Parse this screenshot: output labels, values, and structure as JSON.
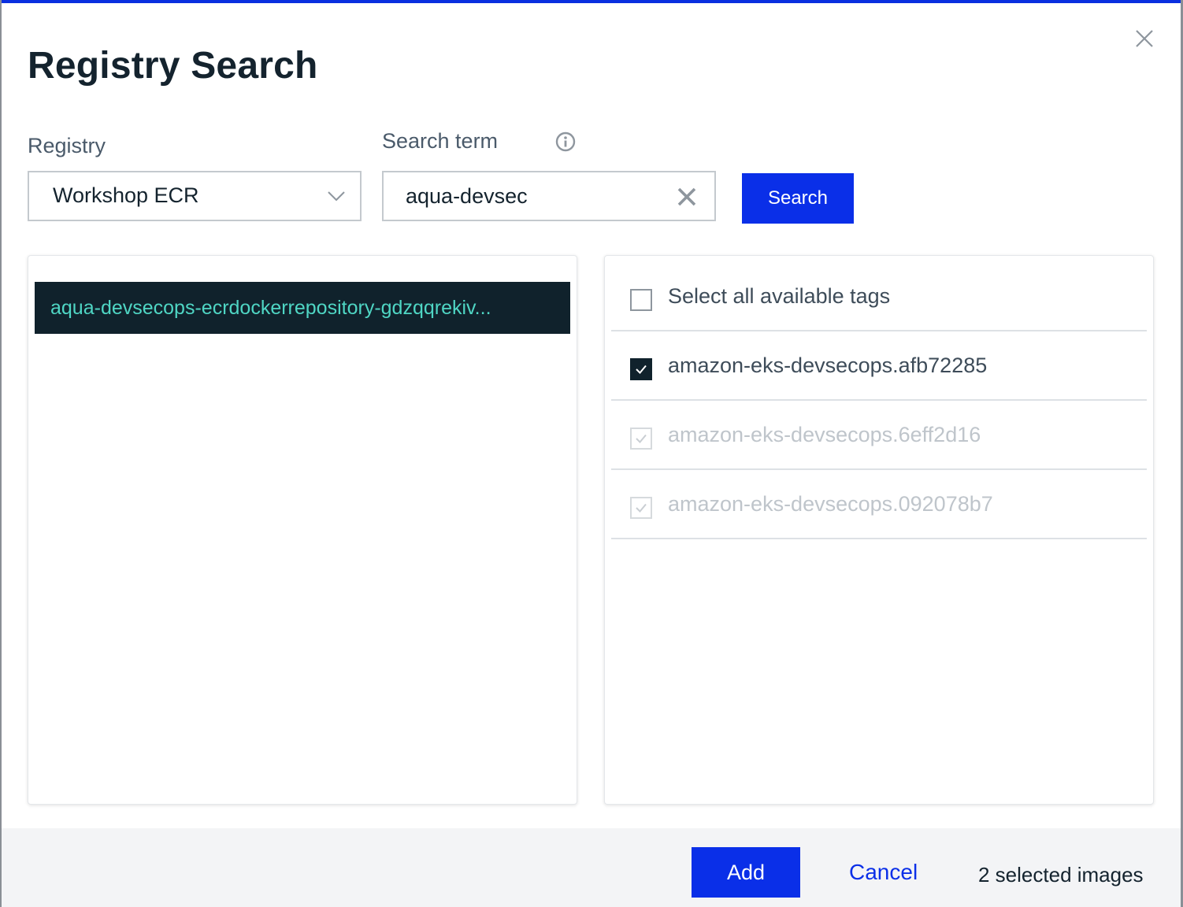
{
  "dialog": {
    "title": "Registry Search"
  },
  "registry": {
    "label": "Registry",
    "selected": "Workshop ECR"
  },
  "search": {
    "label": "Search term",
    "value": "aqua-devsec",
    "button_label": "Search"
  },
  "repositories": [
    {
      "name": "aqua-devsecops-ecrdockerrepository-gdzqqrekiv...",
      "selected": true
    }
  ],
  "tags": {
    "select_all_label": "Select all available tags",
    "items": [
      {
        "label": "amazon-eks-devsecops.afb72285",
        "state": "checked"
      },
      {
        "label": "amazon-eks-devsecops.6eff2d16",
        "state": "disabled-checked"
      },
      {
        "label": "amazon-eks-devsecops.092078b7",
        "state": "disabled-checked"
      }
    ]
  },
  "footer": {
    "add_label": "Add",
    "cancel_label": "Cancel",
    "selected_count": "2 selected images"
  },
  "colors": {
    "accent": "#0a2fe8",
    "dark": "#10222c",
    "repo_text": "#4fd6c4"
  }
}
